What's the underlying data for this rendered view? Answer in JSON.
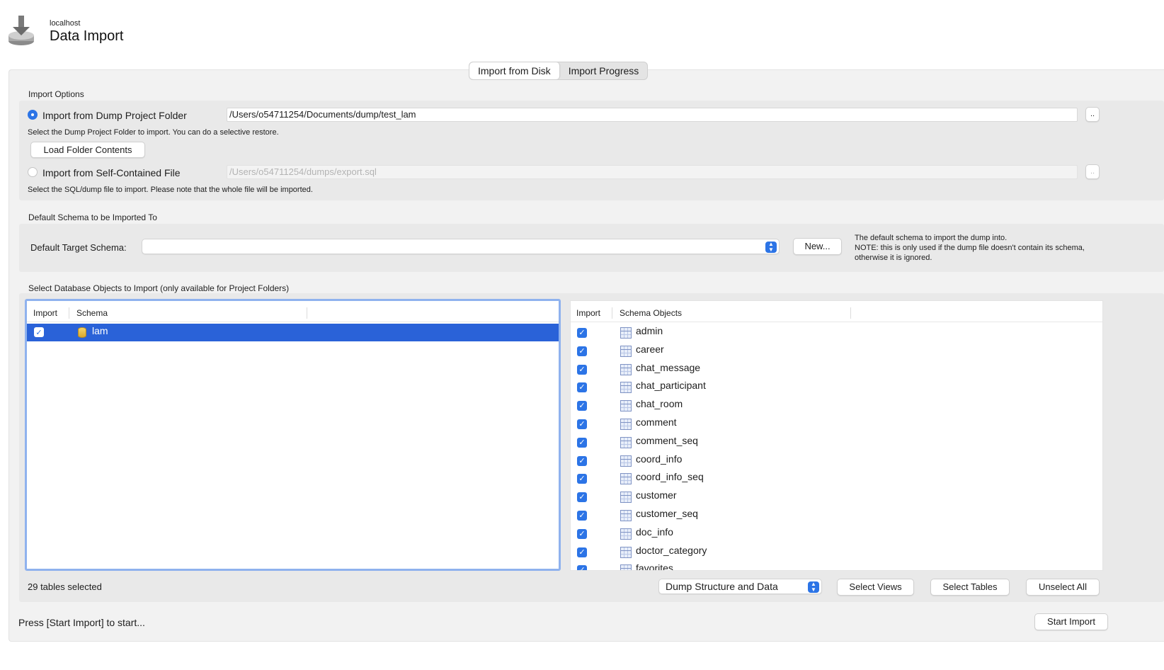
{
  "header": {
    "host": "localhost",
    "title": "Data Import"
  },
  "tabs": [
    {
      "label": "Import from Disk",
      "active": true
    },
    {
      "label": "Import Progress",
      "active": false
    }
  ],
  "import_options": {
    "section_label": "Import Options",
    "dump_folder": {
      "label": "Import from Dump Project Folder",
      "path": "/Users/o54711254/Documents/dump/test_lam",
      "selected": true,
      "browse_label": "..",
      "hint": "Select the Dump Project Folder to import. You can do a selective restore.",
      "load_button": "Load Folder Contents"
    },
    "self_contained": {
      "label": "Import from Self-Contained File",
      "path": "/Users/o54711254/dumps/export.sql",
      "selected": false,
      "browse_label": "..",
      "hint": "Select the SQL/dump file to import. Please note that the whole file will be imported."
    }
  },
  "default_schema": {
    "section_label": "Default Schema to be Imported To",
    "field_label": "Default Target Schema:",
    "value": "",
    "new_button": "New...",
    "note_line1": "The default schema to import the dump into.",
    "note_line2": "NOTE: this is only used if the dump file doesn't contain its schema,",
    "note_line3": "otherwise it is ignored."
  },
  "objects": {
    "section_label": "Select Database Objects to Import (only available for Project Folders)",
    "left_columns": {
      "import": "Import",
      "schema": "Schema"
    },
    "schemas": [
      {
        "name": "lam",
        "checked": true,
        "selected": true
      }
    ],
    "right_columns": {
      "import": "Import",
      "objects": "Schema Objects"
    },
    "tables": [
      "admin",
      "career",
      "chat_message",
      "chat_participant",
      "chat_room",
      "comment",
      "comment_seq",
      "coord_info",
      "coord_info_seq",
      "customer",
      "customer_seq",
      "doc_info",
      "doctor_category",
      "favorites"
    ],
    "status": "29 tables selected",
    "dump_mode": "Dump Structure and Data",
    "select_views": "Select Views",
    "select_tables": "Select Tables",
    "unselect_all": "Unselect All"
  },
  "footer": {
    "status": "Press [Start Import] to start...",
    "start_button": "Start Import"
  },
  "colors": {
    "accent": "#2c74e6",
    "selection": "#2a62d8",
    "panel": "#f2f2f2"
  }
}
